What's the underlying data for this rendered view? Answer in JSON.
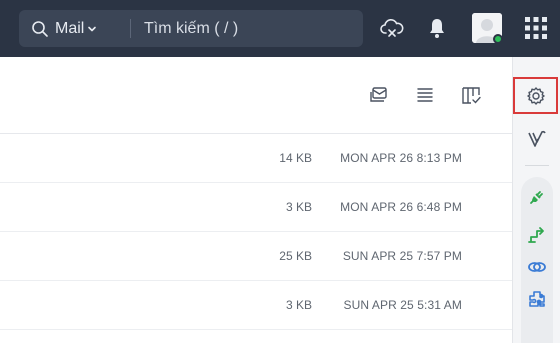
{
  "search": {
    "scope_label": "Mail",
    "placeholder": "Tìm kiếm ( / )"
  },
  "topbar_icons": [
    "search-icon",
    "chevron-down-icon",
    "cloud-sync-icon",
    "bell-icon",
    "avatar",
    "apps-grid-icon"
  ],
  "toolbar_icons": [
    "mail-view-icon",
    "list-density-icon",
    "column-settings-icon"
  ],
  "mails": [
    {
      "size": "14 KB",
      "date": "MON APR 26 8:13 PM"
    },
    {
      "size": "3 KB",
      "date": "MON APR 26 6:48 PM"
    },
    {
      "size": "25 KB",
      "date": "SUN APR 25 7:57 PM"
    },
    {
      "size": "3 KB",
      "date": "SUN APR 25 5:31 AM"
    }
  ],
  "right_rail_icons": [
    "gear-icon",
    "v-logo-icon",
    "plug-icon",
    "route-icon",
    "link-icon",
    "puzzle-icon"
  ],
  "colors": {
    "topbar": "#2b3444",
    "searchbox": "#3b4556",
    "accent_green": "#2fa84f",
    "accent_blue": "#3a7bd5",
    "highlight_red": "#d93a3a"
  }
}
